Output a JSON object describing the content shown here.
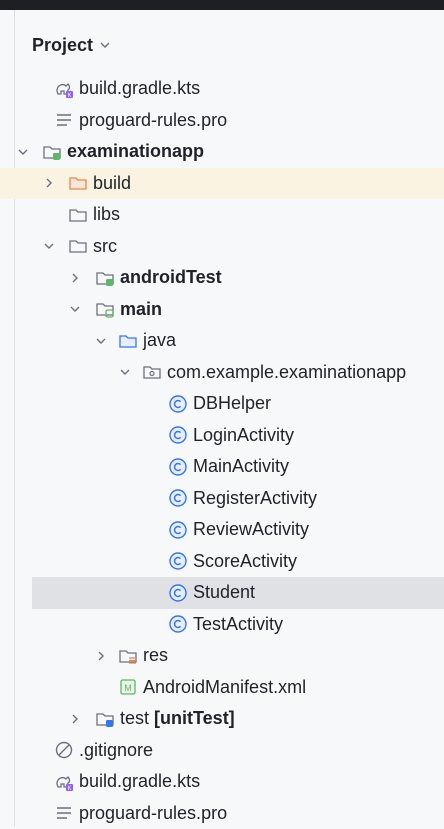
{
  "header": {
    "title": "Project"
  },
  "tree": {
    "r0": "build.gradle.kts",
    "r1": "proguard-rules.pro",
    "r2": "examinationapp",
    "r3": "build",
    "r4": "libs",
    "r5": "src",
    "r6": "androidTest",
    "r7": "main",
    "r8": "java",
    "r9": "com.example.examinationapp",
    "r10": "DBHelper",
    "r11": "LoginActivity",
    "r12": "MainActivity",
    "r13": "RegisterActivity",
    "r14": "ReviewActivity",
    "r15": "ScoreActivity",
    "r16": "Student",
    "r17": "TestActivity",
    "r18": "res",
    "r19": "AndroidManifest.xml",
    "r20a": "test",
    "r20b": "[unitTest]",
    "r21": ".gitignore",
    "r22": "build.gradle.kts",
    "r23": "proguard-rules.pro"
  },
  "colors": {
    "accent_blue": "#3574f0",
    "folder_orange": "#e08855",
    "module_green": "#5fb865",
    "highlight": "#fbf3e1",
    "selected": "#dfe1e5"
  }
}
